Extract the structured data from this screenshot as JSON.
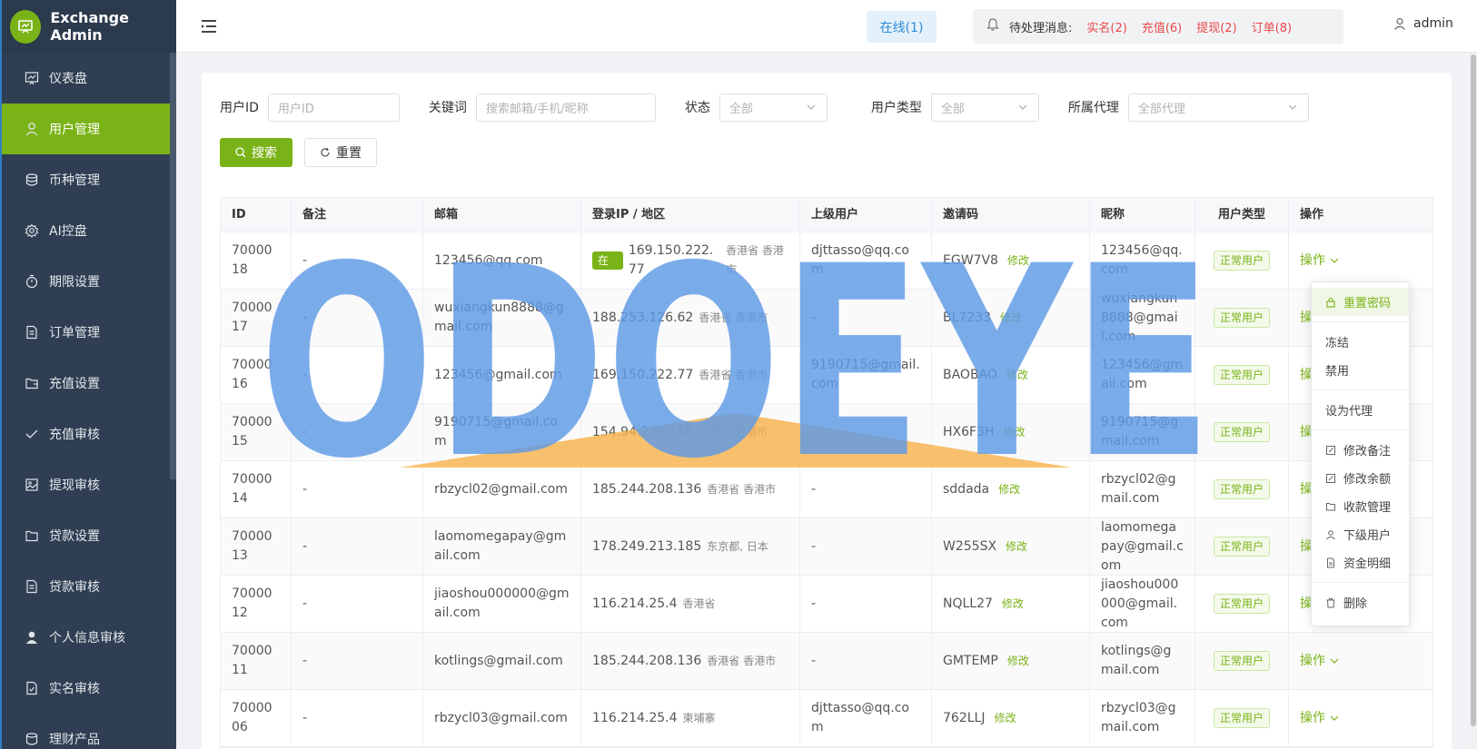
{
  "brand": {
    "title": "Exchange Admin"
  },
  "sidebar": {
    "items": [
      {
        "label": "仪表盘",
        "icon": "dashboard-icon"
      },
      {
        "label": "用户管理",
        "icon": "user-icon",
        "active": true
      },
      {
        "label": "币种管理",
        "icon": "database-icon"
      },
      {
        "label": "AI控盘",
        "icon": "settings-icon"
      },
      {
        "label": "期限设置",
        "icon": "timer-icon"
      },
      {
        "label": "订单管理",
        "icon": "document-icon"
      },
      {
        "label": "充值设置",
        "icon": "wallet-icon"
      },
      {
        "label": "充值审核",
        "icon": "check-icon"
      },
      {
        "label": "提现审核",
        "icon": "picture-icon"
      },
      {
        "label": "贷款设置",
        "icon": "folder-icon"
      },
      {
        "label": "贷款审核",
        "icon": "document-icon"
      },
      {
        "label": "个人信息审核",
        "icon": "avatar-icon"
      },
      {
        "label": "实名审核",
        "icon": "document-check-icon"
      },
      {
        "label": "理财产品",
        "icon": "coins-icon"
      }
    ]
  },
  "header": {
    "online": "在线(1)",
    "pending_label": "待处理消息:",
    "pending": [
      "实名(2)",
      "充值(6)",
      "提现(2)",
      "订单(8)"
    ],
    "user": "admin"
  },
  "filters": {
    "user_id_label": "用户ID",
    "user_id_placeholder": "用户ID",
    "keyword_label": "关键词",
    "keyword_placeholder": "搜索邮箱/手机/昵称",
    "status_label": "状态",
    "status_value": "全部",
    "type_label": "用户类型",
    "type_value": "全部",
    "agent_label": "所属代理",
    "agent_value": "全部代理",
    "search_button": "搜索",
    "reset_button": "重置"
  },
  "table": {
    "columns": [
      "ID",
      "备注",
      "邮箱",
      "登录IP / 地区",
      "上级用户",
      "邀请码",
      "昵称",
      "用户类型",
      "操作"
    ],
    "edit_label": "修改",
    "online_tag": "在线",
    "type_tag": "正常用户",
    "op_label": "操作",
    "rows": [
      {
        "id": "7000018",
        "note": "-",
        "email": "123456@qq.com",
        "online": true,
        "ip": "169.150.222.77",
        "region": "香港省 香港市",
        "parent": "djttasso@qq.com",
        "code": "EGW7V8",
        "nick": "123456@qq.com"
      },
      {
        "id": "7000017",
        "note": "-",
        "email": "wuxiangkun8888@gmail.com",
        "online": false,
        "ip": "188.253.126.62",
        "region": "香港省 香港市",
        "parent": "-",
        "code": "BL7233",
        "nick": "wuxiangkun8888@gmail.com"
      },
      {
        "id": "7000016",
        "note": "-",
        "email": "123456@gmail.com",
        "online": false,
        "ip": "169.150.222.77",
        "region": "香港省 香港市",
        "parent": "9190715@gmail.com",
        "code": "BAOBAO",
        "nick": "123456@gmail.com"
      },
      {
        "id": "7000015",
        "note": "-",
        "email": "9190715@gmail.com",
        "online": false,
        "ip": "154.94.226.118",
        "region": "香港省 香港市",
        "parent": "-",
        "code": "HX6F3H",
        "nick": "9190715@gmail.com"
      },
      {
        "id": "7000014",
        "note": "-",
        "email": "rbzycl02@gmail.com",
        "online": false,
        "ip": "185.244.208.136",
        "region": "香港省 香港市",
        "parent": "-",
        "code": "sddada",
        "nick": "rbzycl02@gmail.com"
      },
      {
        "id": "7000013",
        "note": "-",
        "email": "laomomegapay@gmail.com",
        "online": false,
        "ip": "178.249.213.185",
        "region": "东京都, 日本",
        "parent": "-",
        "code": "W255SX",
        "nick": "laomomegapay@gmail.com"
      },
      {
        "id": "7000012",
        "note": "-",
        "email": "jiaoshou000000@gmail.com",
        "online": false,
        "ip": "116.214.25.4",
        "region": "香港省",
        "parent": "-",
        "code": "NQLL27",
        "nick": "jiaoshou000000@gmail.com"
      },
      {
        "id": "7000011",
        "note": "-",
        "email": "kotlings@gmail.com",
        "online": false,
        "ip": "185.244.208.136",
        "region": "香港省 香港市",
        "parent": "-",
        "code": "GMTEMP",
        "nick": "kotlings@gmail.com"
      },
      {
        "id": "7000006",
        "note": "-",
        "email": "rbzycl03@gmail.com",
        "online": false,
        "ip": "116.214.25.4",
        "region": "柬埔寨",
        "parent": "djttasso@qq.com",
        "code": "762LLJ",
        "nick": "rbzycl03@gmail.com"
      }
    ]
  },
  "dropdown": {
    "items": [
      {
        "label": "重置密码",
        "icon": "lock-icon",
        "highlight": true
      },
      {
        "sep": true
      },
      {
        "label": "冻结"
      },
      {
        "label": "禁用"
      },
      {
        "sep": true
      },
      {
        "label": "设为代理"
      },
      {
        "sep": true
      },
      {
        "label": "修改备注",
        "icon": "edit-icon"
      },
      {
        "label": "修改余额",
        "icon": "edit-icon"
      },
      {
        "label": "收款管理",
        "icon": "wallet-icon"
      },
      {
        "label": "下级用户",
        "icon": "user-icon"
      },
      {
        "label": "资金明细",
        "icon": "document-icon"
      },
      {
        "sep": true
      },
      {
        "label": "删除",
        "icon": "trash-icon"
      }
    ]
  },
  "watermark": {
    "text": "ODOEYE"
  },
  "colors": {
    "accent": "#7ab317",
    "sidebar": "#2f3e52",
    "danger": "#e84a4a",
    "info": "#2b8ad8"
  }
}
